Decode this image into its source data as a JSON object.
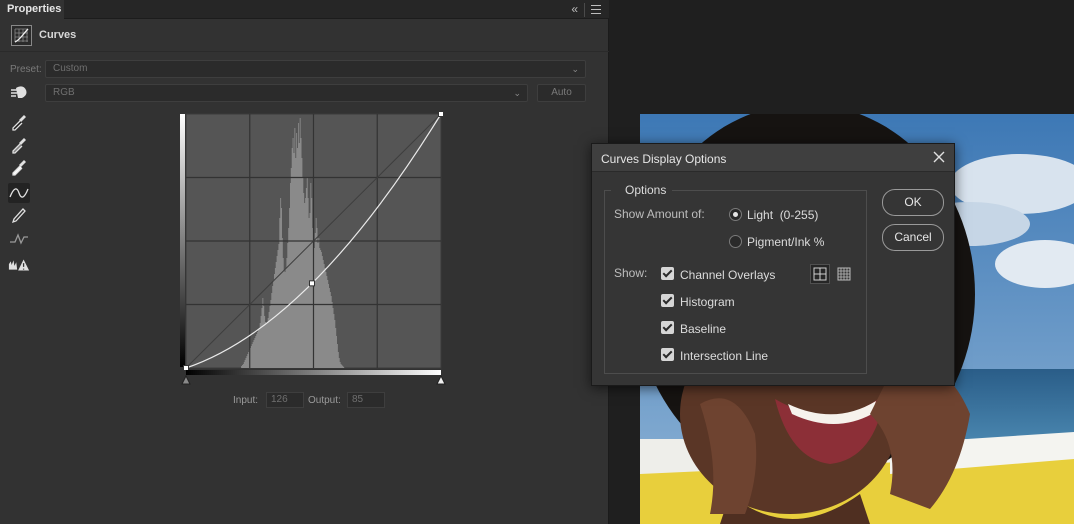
{
  "panel": {
    "tab_label": "Properties",
    "collapse_glyph": "«",
    "header_title": "Curves",
    "preset_label": "Preset:",
    "preset_value": "Custom",
    "channel_value": "RGB",
    "auto_label": "Auto",
    "tools": [
      "target-adjust-icon",
      "black-point-eyedropper-icon",
      "gray-point-eyedropper-icon",
      "white-point-eyedropper-icon",
      "curve-points-icon",
      "pencil-icon",
      "smooth-icon",
      "clipping-warning-icon"
    ],
    "active_tool": "curve-points-icon"
  },
  "curve": {
    "input_label": "Input:",
    "input_value": "126",
    "output_label": "Output:",
    "output_value": "85",
    "points": [
      [
        0,
        0
      ],
      [
        126,
        85
      ],
      [
        255,
        255
      ]
    ],
    "histogram": [
      0,
      0,
      0,
      0,
      0,
      0,
      0,
      0,
      0,
      0,
      0,
      0,
      0,
      0,
      0,
      0,
      0,
      0,
      0,
      0,
      0,
      0,
      0,
      0,
      0,
      0,
      0,
      0,
      0,
      0,
      0,
      0,
      0,
      0,
      0,
      0,
      0,
      0,
      0,
      0,
      0,
      0,
      0,
      0,
      0,
      0,
      0,
      0,
      0,
      0,
      0,
      0,
      0,
      0,
      0,
      0,
      0,
      0,
      0,
      0,
      0,
      0,
      2,
      3,
      4,
      6,
      8,
      10,
      12,
      14,
      16,
      18,
      20,
      22,
      24,
      26,
      28,
      30,
      32,
      34,
      36,
      38,
      40,
      45,
      52,
      60,
      70,
      62,
      52,
      46,
      44,
      46,
      50,
      56,
      62,
      68,
      75,
      82,
      88,
      94,
      100,
      106,
      112,
      118,
      124,
      150,
      170,
      160,
      130,
      110,
      98,
      96,
      100,
      110,
      125,
      140,
      160,
      185,
      200,
      220,
      230,
      215,
      240,
      210,
      235,
      220,
      245,
      225,
      250,
      230,
      210,
      190,
      175,
      165,
      170,
      180,
      190,
      170,
      150,
      155,
      185,
      170,
      140,
      130,
      120,
      135,
      150,
      140,
      125,
      130,
      120,
      118,
      116,
      112,
      108,
      104,
      100,
      96,
      92,
      88,
      84,
      80,
      76,
      72,
      66,
      60,
      54,
      48,
      40,
      32,
      24,
      16,
      10,
      6,
      4,
      3,
      2,
      1,
      0,
      0,
      0,
      0,
      0,
      0,
      0,
      0,
      0,
      0,
      0,
      0,
      0,
      0,
      0,
      0,
      0,
      0,
      0,
      0,
      0,
      0,
      0,
      0,
      0,
      0,
      0,
      0,
      0,
      0,
      0,
      0,
      0,
      0,
      0,
      0,
      0,
      0,
      0,
      0,
      0,
      0,
      0,
      0,
      0,
      0,
      0,
      0,
      0,
      0,
      0,
      0,
      0,
      0,
      0,
      0,
      0,
      0,
      0,
      0,
      0,
      0,
      0,
      0,
      0,
      0,
      0,
      0,
      0,
      0,
      0,
      0,
      0,
      0,
      0,
      0,
      0,
      0,
      0,
      0,
      0,
      0,
      0,
      0,
      0,
      0,
      0,
      0,
      0,
      0,
      0,
      0,
      0,
      0,
      0,
      0,
      0,
      0,
      0,
      0,
      0,
      0,
      0,
      0,
      0,
      0,
      0,
      0,
      0
    ]
  },
  "dialog": {
    "title": "Curves Display Options",
    "group_title": "Options",
    "show_amount_label": "Show Amount of:",
    "light_label": "Light  (0-255)",
    "pigment_label": "Pigment/Ink %",
    "selected_amount": "light",
    "show_label": "Show:",
    "checks": [
      {
        "label": "Channel Overlays",
        "checked": true
      },
      {
        "label": "Histogram",
        "checked": true
      },
      {
        "label": "Baseline",
        "checked": true
      },
      {
        "label": "Intersection Line",
        "checked": true
      }
    ],
    "grid_options": [
      "simple-grid-icon",
      "detailed-grid-icon"
    ],
    "grid_selected": "simple-grid-icon",
    "ok_label": "OK",
    "cancel_label": "Cancel"
  },
  "colors": {
    "panel_bg": "#323232",
    "app_bg": "#1f1f1f",
    "graph_bg": "#555555",
    "curve": "#e8e8e8",
    "histogram": "#8a8a8a"
  }
}
